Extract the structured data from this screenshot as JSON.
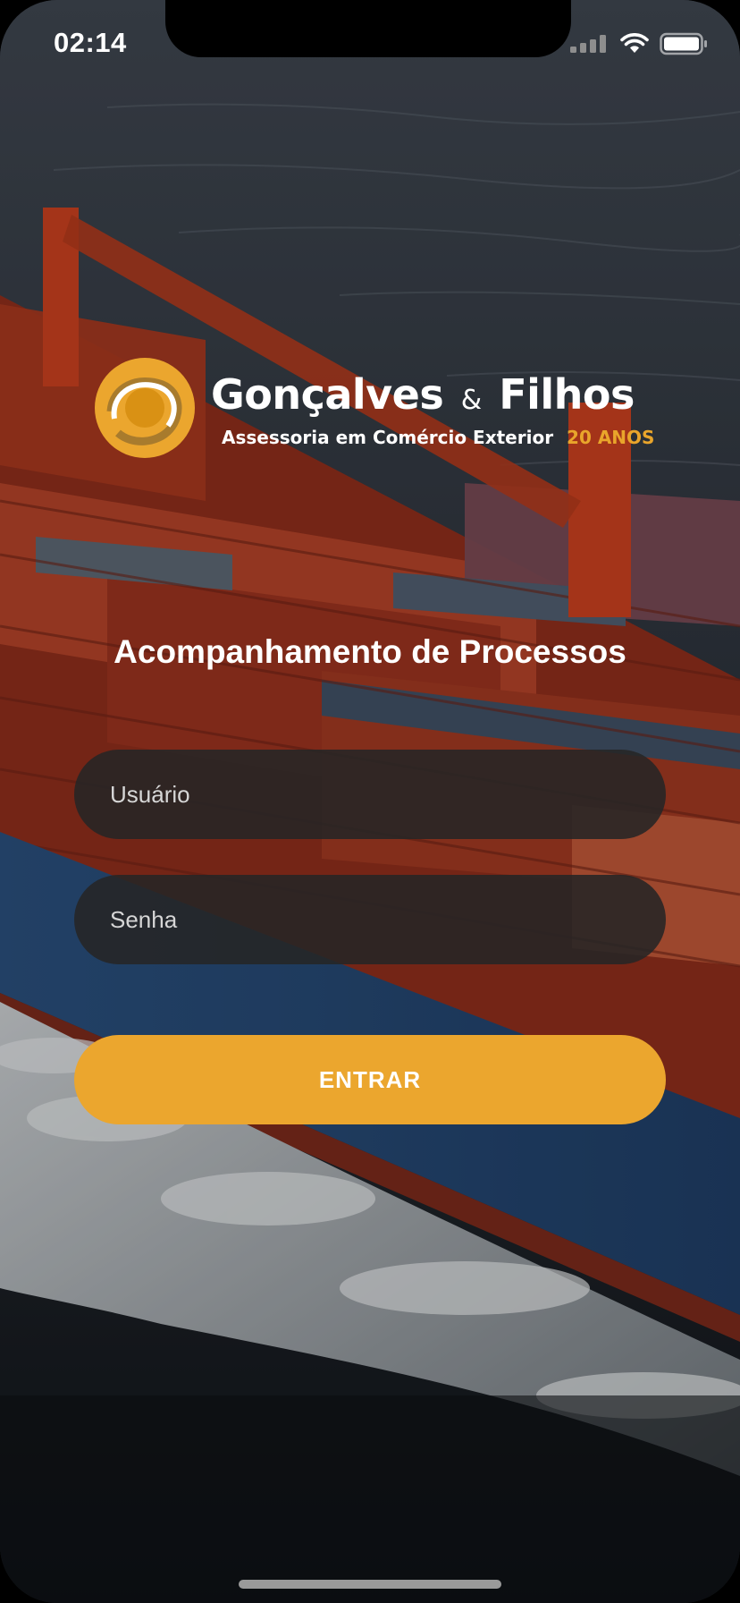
{
  "status_bar": {
    "time": "02:14",
    "icons": [
      "cellular-signal-icon",
      "wifi-icon",
      "battery-icon"
    ]
  },
  "logo": {
    "name_part1": "Gonçalves",
    "ampersand": "&",
    "name_part2": "Filhos",
    "tagline": "Assessoria em Comércio Exterior",
    "anniversary": "20 ANOS"
  },
  "title": "Acompanhamento de Processos",
  "form": {
    "username_placeholder": "Usuário",
    "username_value": "",
    "password_placeholder": "Senha",
    "password_value": "",
    "submit_label": "ENTRAR"
  },
  "colors": {
    "accent": "#eba62e",
    "input_background": "#262626",
    "text": "#ffffff"
  }
}
